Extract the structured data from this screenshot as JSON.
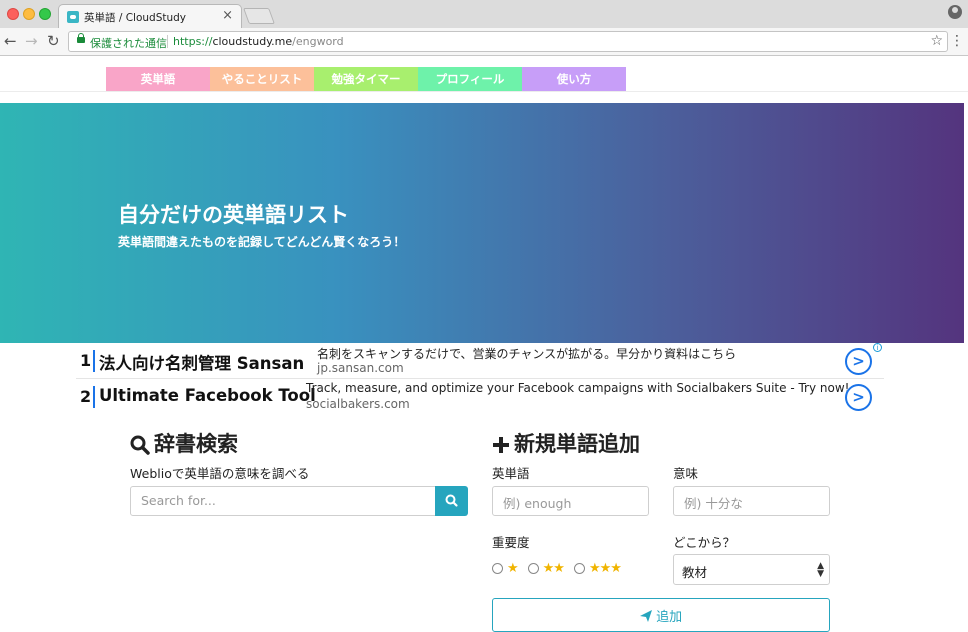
{
  "browser": {
    "tab_title": "英単語 / CloudStudy",
    "tab_close": "×",
    "secure_label": "保護された通信",
    "url_scheme": "https://",
    "url_host": "cloudstudy.me",
    "url_path": "/engword"
  },
  "nav": {
    "items": [
      {
        "label": "英単語",
        "color": "#f9a5c8"
      },
      {
        "label": "やることリスト",
        "color": "#fcc09a"
      },
      {
        "label": "勉強タイマー",
        "color": "#a8ef6e"
      },
      {
        "label": "プロフィール",
        "color": "#6ef2aa"
      },
      {
        "label": "使い方",
        "color": "#c79ef8"
      }
    ]
  },
  "hero": {
    "title": "自分だけの英単語リスト",
    "subtitle": "英単語間違えたものを記録してどんどん賢くなろう！"
  },
  "ads": [
    {
      "num": "1",
      "title": "法人向け名刺管理 Sansan",
      "desc": "名刺をスキャンするだけで、営業のチャンスが拡がる。早分かり資料はこちら",
      "site": "jp.sansan.com"
    },
    {
      "num": "2",
      "title": "Ultimate Facebook Tool",
      "desc": "Track, measure, and optimize your Facebook campaigns with Socialbakers Suite - Try now!",
      "site": "socialbakers.com"
    }
  ],
  "search": {
    "title": "辞書検索",
    "description": "Weblioで英単語の意味を調べる",
    "placeholder": "Search for..."
  },
  "new_word": {
    "title": "新規単語追加",
    "word_label": "英単語",
    "word_placeholder": "例) enough",
    "meaning_label": "意味",
    "meaning_placeholder": "例) 十分な",
    "importance_label": "重要度",
    "importance_options": [
      "★",
      "★★",
      "★★★"
    ],
    "source_label": "どこから？",
    "source_value": "教材",
    "add_label": "追加"
  },
  "colors": {
    "accent": "#26a5be",
    "hero_start": "#2fb5b4",
    "hero_end": "#54347e"
  }
}
